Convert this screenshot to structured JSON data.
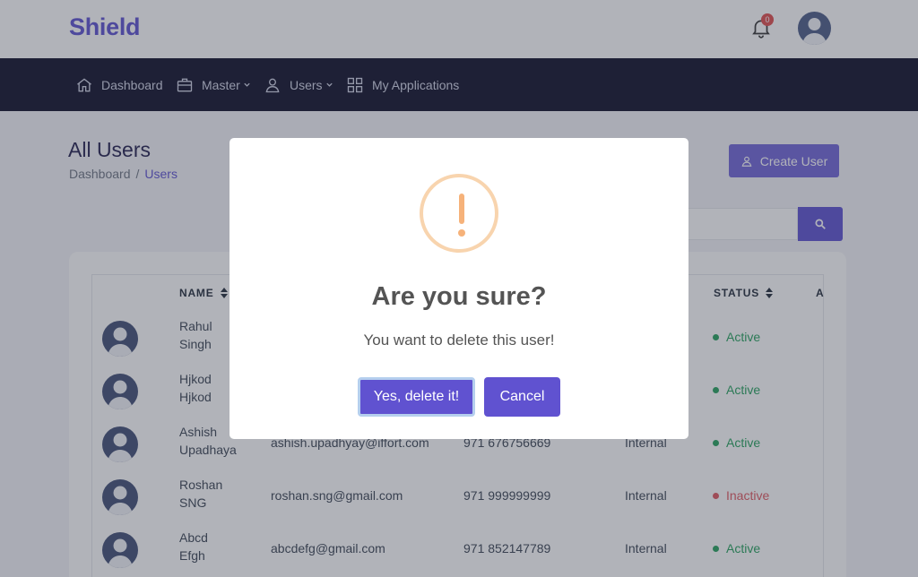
{
  "brand": "Shield",
  "notifications": {
    "count": "0"
  },
  "nav": [
    {
      "label": "Dashboard",
      "icon": "home-icon"
    },
    {
      "label": "Master",
      "icon": "briefcase-icon",
      "dropdown": true
    },
    {
      "label": "Users",
      "icon": "user-icon",
      "dropdown": true
    },
    {
      "label": "My Applications",
      "icon": "grid-icon"
    }
  ],
  "page": {
    "title": "All Users",
    "breadcrumb": [
      "Dashboard",
      "/",
      "Users"
    ],
    "create_button": "Create User",
    "search_placeholder": ""
  },
  "table": {
    "columns": [
      "NAME",
      "STATUS",
      "A"
    ],
    "rows": [
      {
        "name_first": "Rahul",
        "name_last": "Singh",
        "email": "",
        "phone": "",
        "type": "",
        "status": "Active"
      },
      {
        "name_first": "Hjkod",
        "name_last": "Hjkod",
        "email": "",
        "phone": "",
        "type": "",
        "status": "Active"
      },
      {
        "name_first": "Ashish",
        "name_last": "Upadhaya",
        "email": "ashish.upadhyay@iffort.com",
        "phone": "971 676756669",
        "type": "Internal",
        "status": "Active"
      },
      {
        "name_first": "Roshan",
        "name_last": "SNG",
        "email": "roshan.sng@gmail.com",
        "phone": "971 999999999",
        "type": "Internal",
        "status": "Inactive"
      },
      {
        "name_first": "Abcd",
        "name_last": "Efgh",
        "email": "abcdefg@gmail.com",
        "phone": "971 852147789",
        "type": "Internal",
        "status": "Active"
      }
    ]
  },
  "modal": {
    "icon": "warning-icon",
    "title": "Are you sure?",
    "text": "You want to delete this user!",
    "confirm_label": "Yes, delete it!",
    "cancel_label": "Cancel"
  },
  "colors": {
    "brand": "#5b4fd1",
    "nav_bg": "#0b0b26",
    "active": "#22a05a",
    "inactive": "#e0555e",
    "warning": "#f6b27a"
  }
}
